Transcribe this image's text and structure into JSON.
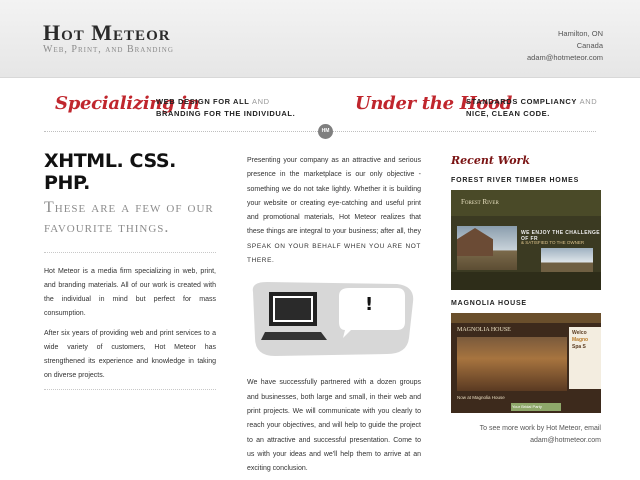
{
  "header": {
    "title": "Hot Meteor",
    "subtitle": "Web, Print, and Branding",
    "contact": {
      "city": "Hamilton, ON",
      "country": "Canada",
      "email": "adam@hotmeteor.com"
    }
  },
  "band": {
    "left_script": "Specializing in",
    "left_tag_line1_bold": "Web design for all",
    "left_tag_line1_light": "and",
    "left_tag_line2": "Branding for the individual.",
    "right_script": "Under the Hood",
    "right_tag_line1_bold": "Standards Compliancy",
    "right_tag_line1_light": "and",
    "right_tag_line2": "nice, clean Code.",
    "badge": "HM"
  },
  "left": {
    "heading": "XHTML. CSS. PHP.",
    "subheading": "These are a few of our favourite things.",
    "para1": "Hot Meteor is a media firm specializing in web, print, and branding materials. All of our work is created with the individual in mind but perfect for mass consumption.",
    "para2": "After six years of providing web and print services to a wide variety of customers, Hot Meteor has strengthened its experience and knowledge in taking on diverse projects."
  },
  "middle": {
    "para1_a": "Presenting your company as an attractive and serious presence in the marketplace is our only objective - something we do not take lightly. Whether it is building your website or creating eye-catching and useful print and promotional materials, Hot Meteor realizes that these things are integral to your business; after all, they",
    "para1_b": "speak on your behalf when you are not there.",
    "bubble": "!",
    "para2": "We have successfully partnered with a dozen groups and businesses, both large and small, in their web and print projects. We will communicate with you clearly to reach your objectives, and will help to guide the project to an attractive and successful presentation. Come to us with your ideas and we'll help them to arrive at an exciting conclusion."
  },
  "right": {
    "heading": "Recent Work",
    "projects": [
      {
        "title": "FOREST RIVER TIMBER HOMES",
        "shot_brand": "Forest River",
        "shot_tagline": "WE ENJOY THE CHALLENGE OF FR",
        "shot_tagline2": "& SATISFIED TO THE OWNER"
      },
      {
        "title": "MAGNOLIA HOUSE",
        "shot_brand": "MAGNOLIA HOUSE",
        "shot_side1": "Welco",
        "shot_side2": "Magno",
        "shot_side3": "Spa S",
        "shot_news": "Now at Magnolia House",
        "shot_note": "Your Bridal Party"
      }
    ],
    "more_line1": "To see more work by Hot Meteor, email",
    "more_line2": "adam@hotmeteor.com"
  }
}
